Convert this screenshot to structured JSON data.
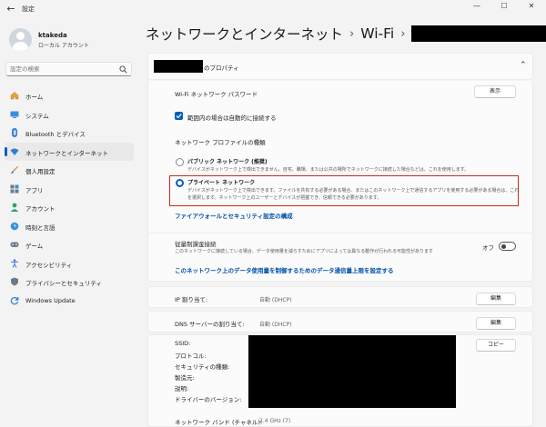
{
  "window": {
    "title": "設定",
    "controls": {
      "minimize": "—",
      "maximize": "☐",
      "close": "✕"
    }
  },
  "profile": {
    "name": "ktakeda",
    "type": "ローカル アカウント"
  },
  "search": {
    "placeholder": "設定の検索"
  },
  "nav": {
    "items": [
      {
        "label": "ホーム",
        "icon": "home-icon"
      },
      {
        "label": "システム",
        "icon": "system-icon"
      },
      {
        "label": "Bluetooth とデバイス",
        "icon": "bluetooth-icon"
      },
      {
        "label": "ネットワークとインターネット",
        "icon": "wifi-icon",
        "active": true
      },
      {
        "label": "個人用設定",
        "icon": "brush-icon"
      },
      {
        "label": "アプリ",
        "icon": "apps-icon"
      },
      {
        "label": "アカウント",
        "icon": "account-icon"
      },
      {
        "label": "時刻と言語",
        "icon": "clock-icon"
      },
      {
        "label": "ゲーム",
        "icon": "game-icon"
      },
      {
        "label": "アクセシビリティ",
        "icon": "accessibility-icon"
      },
      {
        "label": "プライバシーとセキュリティ",
        "icon": "shield-icon"
      },
      {
        "label": "Windows Update",
        "icon": "update-icon"
      }
    ]
  },
  "header": {
    "crumb1": "ネットワークとインターネット",
    "sep": "›",
    "crumb2": "Wi-Fi"
  },
  "properties": {
    "title_suffix": "のプロパティ",
    "wifi_password_label": "Wi-Fi ネットワーク パスワード",
    "show_button": "表示",
    "auto_connect_label": "範囲内の場合は自動的に接続する",
    "profile_type_heading": "ネットワーク プロファイルの種類",
    "public_title": "パブリック ネットワーク (推奨)",
    "public_desc": "デバイスがネットワーク上で検出できません。自宅、職場、または公共の場所でネットワークに接続した場合などは、これを使用します。",
    "private_title": "プライベート ネットワーク",
    "private_desc_1": "デバイスがネットワーク上で検出できます。ファイルを共有する必要がある場合、またはこのネットワーク上で通信するアプリを使用する必要がある場合は、これ",
    "private_desc_2": "を選択します。ネットワーク上のユーザーとデバイスが把握でき、信頼できる必要があります。",
    "firewall_link": "ファイアウォールとセキュリティ設定の構成",
    "metered_label": "従量制課金接続",
    "metered_desc": "このネットワークに接続している場合、データ使用量を減らすためにアプリによっては異なる動作が行われる可能性があります",
    "metered_state": "オフ",
    "data_limit_link": "このネットワーク上のデータ使用量を制御するためのデータ通信量上限を設定する",
    "ip_label": "IP 割り当て:",
    "ip_value": "自動 (DHCP)",
    "ip_edit": "編集",
    "dns_label": "DNS サーバーの割り当て:",
    "dns_value": "自動 (DHCP)",
    "dns_edit": "編集",
    "copy_button": "コピー",
    "details": [
      {
        "label": "SSID:"
      },
      {
        "label": "プロトコル:"
      },
      {
        "label": "セキュリティの種類:"
      },
      {
        "label": "製造元:"
      },
      {
        "label": "説明:"
      },
      {
        "label": "ドライバーのバージョン:"
      }
    ],
    "band_label": "ネットワーク バンド (チャネル):",
    "band_value": "2.4 GHz (7)"
  },
  "colors": {
    "accent": "#005fb8",
    "highlight": "#c42b1c",
    "link": "#0050a8"
  }
}
